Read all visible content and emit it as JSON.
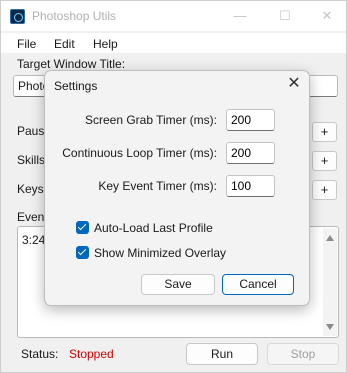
{
  "window": {
    "title": "Photoshop Utils",
    "controls": {
      "minimize": "—",
      "maximize": "☐",
      "close": "✕"
    }
  },
  "menu": {
    "file": "File",
    "edit": "Edit",
    "help": "Help"
  },
  "main": {
    "target_window_label": "Target Window Title:",
    "target_window_value": "Photo",
    "pause_label": "Pause",
    "skills_label": "Skills:",
    "keys_label": "Keys:",
    "events_label": "Event",
    "events_text": "3:24",
    "add_button": "+",
    "status_label": "Status:",
    "status_value": "Stopped",
    "status_color": "#d10000",
    "run_button": "Run",
    "stop_button": "Stop"
  },
  "dialog": {
    "title": "Settings",
    "close": "✕",
    "fields": [
      {
        "label": "Screen Grab Timer (ms):",
        "value": "200"
      },
      {
        "label": "Continuous Loop Timer (ms):",
        "value": "200"
      },
      {
        "label": "Key Event Timer (ms):",
        "value": "100"
      }
    ],
    "checkboxes": [
      {
        "label": "Auto-Load Last Profile",
        "checked": true
      },
      {
        "label": "Show Minimized Overlay",
        "checked": true
      }
    ],
    "save_button": "Save",
    "cancel_button": "Cancel",
    "accent_color": "#0067c0"
  }
}
